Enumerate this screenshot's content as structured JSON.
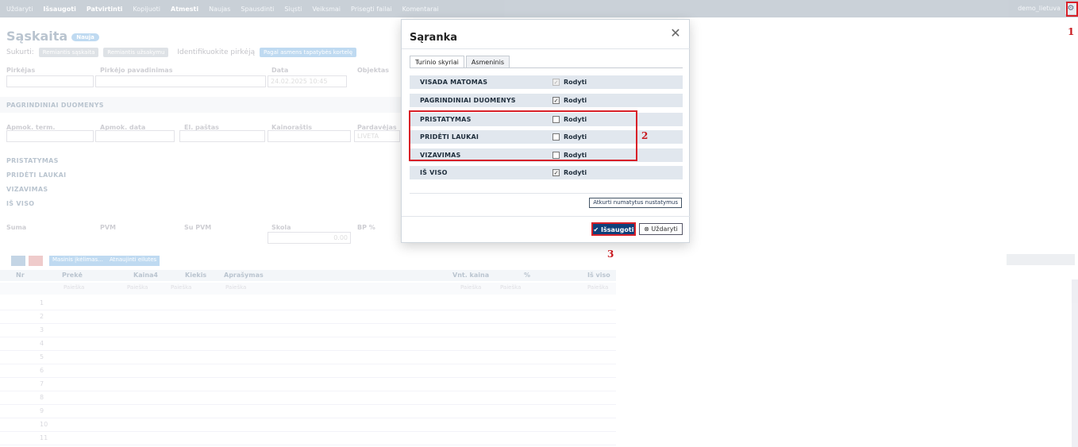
{
  "toolbar": {
    "items": [
      "Uždaryti",
      "Išsaugoti",
      "Patvirtinti",
      "Kopijuoti",
      "Atmesti",
      "Naujas",
      "Spausdinti",
      "Siųsti",
      "Veiksmai",
      "Prisegti failai",
      "Komentarai"
    ],
    "user": "demo_lietuva",
    "gear_icon": "gear-icon"
  },
  "page": {
    "title": "Sąskaita",
    "badge": "Nauja",
    "created_label": "Sukurti:",
    "created_pills": [
      "Remiantis sąskaita",
      "Remiantis užsakymu"
    ],
    "identify_label": "Identifikuokite pirkėją",
    "identify_pill": "Pagal asmens tapatybės kortelę"
  },
  "fields": {
    "row1": [
      "Pirkėjas",
      "Pirkėjo pavadinimas",
      "Data",
      "Objektas"
    ],
    "date_value": "24.02.2025 10:45",
    "row2": [
      "Apmok. term.",
      "Apmok. data",
      "El. paštas",
      "Kainoraštis",
      "Pardavėjas"
    ],
    "seller_value": "LIVETA",
    "row3": [
      "Suma",
      "PVM",
      "Su PVM",
      "Skola",
      "BP %"
    ],
    "debt_value": "0.00"
  },
  "sections": {
    "main": "PAGRINDINIAI DUOMENYS",
    "presentation": "PRISTATYMAS",
    "added_fields": "PRIDĖTI LAUKAI",
    "approval": "VIZAVIMAS",
    "total": "IŠ VISO"
  },
  "rows_buttons": [
    "Masinis įkėlimas...",
    "Atnaujinti eilutes"
  ],
  "table": {
    "columns": [
      "Nr",
      "Prekė",
      "Kaina4",
      "Kiekis",
      "Aprašymas",
      "Vnt. kaina",
      "%",
      "Iš viso"
    ],
    "search_placeholder": "Paieška",
    "row_numbers": [
      "1",
      "2",
      "3",
      "4",
      "5",
      "6",
      "7",
      "8",
      "9",
      "10",
      "11"
    ]
  },
  "modal": {
    "title": "Sąranka",
    "tabs": [
      "Turinio skyriai",
      "Asmeninis"
    ],
    "rows": [
      {
        "name": "VISADA MATOMAS",
        "label": "Rodyti",
        "checked": true,
        "disabled": true
      },
      {
        "name": "PAGRINDINIAI DUOMENYS",
        "label": "Rodyti",
        "checked": true,
        "disabled": false
      },
      {
        "name": "PRISTATYMAS",
        "label": "Rodyti",
        "checked": false,
        "disabled": false
      },
      {
        "name": "PRIDĖTI LAUKAI",
        "label": "Rodyti",
        "checked": false,
        "disabled": false
      },
      {
        "name": "VIZAVIMAS",
        "label": "Rodyti",
        "checked": false,
        "disabled": false
      },
      {
        "name": "IŠ VISO",
        "label": "Rodyti",
        "checked": true,
        "disabled": false
      }
    ],
    "reset_label": "Atkurti numatytus nustatymus",
    "save_label": "Išsaugoti",
    "close_label": "Uždaryti"
  },
  "annotations": {
    "n1": "1",
    "n2": "2",
    "n3": "3",
    "color": "#d82028"
  }
}
